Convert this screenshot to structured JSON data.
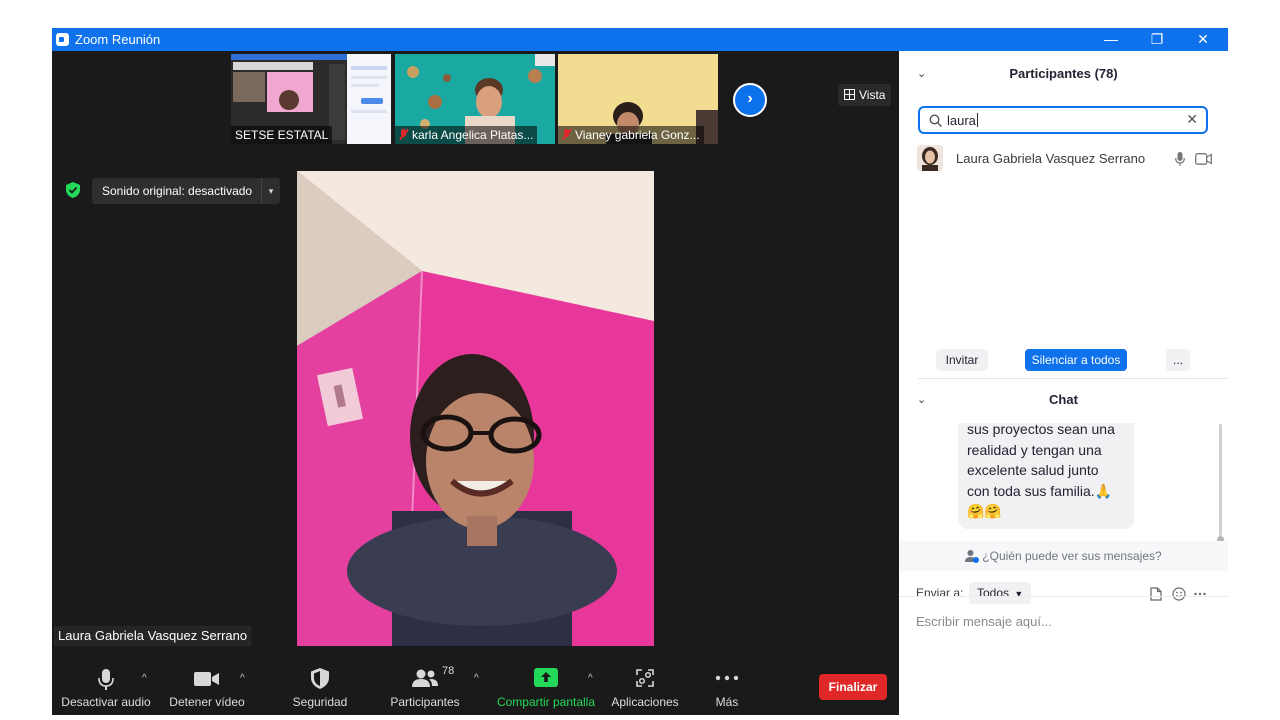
{
  "window": {
    "title": "Zoom Reunión",
    "controls": {
      "minimize": "—",
      "restore": "❐",
      "close": "✕"
    }
  },
  "gallery": {
    "thumbnails": [
      {
        "name": "SETSE ESTATAL",
        "muted": false
      },
      {
        "name": "karla Angelica  Platas...",
        "muted": true
      },
      {
        "name": "Vianey gabriela Gonz...",
        "muted": true
      }
    ],
    "next_label": "›",
    "view_label": "Vista"
  },
  "audio_status": {
    "label": "Sonido original: desactivado",
    "caret": "▾"
  },
  "active_speaker": {
    "name": "Laura Gabriela Vasquez Serrano"
  },
  "toolbar": {
    "mute_label": "Desactivar audio",
    "video_label": "Detener vídeo",
    "security_label": "Seguridad",
    "participants_label": "Participantes",
    "participants_count": "78",
    "share_label": "Compartir pantalla",
    "apps_label": "Aplicaciones",
    "more_label": "Más",
    "end_label": "Finalizar",
    "caret": "^"
  },
  "participants_panel": {
    "title": "Participantes (78)",
    "search_value": "laura",
    "results": [
      {
        "name": "Laura Gabriela Vasquez Serrano"
      }
    ],
    "invite_label": "Invitar",
    "mute_all_label": "Silenciar a todos",
    "more_label": "..."
  },
  "chat_panel": {
    "title": "Chat",
    "message_lines": [
      "sus proyectos sean una",
      "realidad y tengan una",
      "excelente salud junto",
      "con toda sus familia.🙏",
      "🤗🤗"
    ],
    "who_can_see": "¿Quién puede ver sus mensajes?",
    "send_to_label": "Enviar a:",
    "send_to_value": "Todos",
    "input_placeholder": "Escribir mensaje aquí..."
  },
  "colors": {
    "zoom_blue": "#0e72ed",
    "end_red": "#e02828",
    "share_green": "#23d959",
    "meeting_bg": "#1a1a1a"
  }
}
